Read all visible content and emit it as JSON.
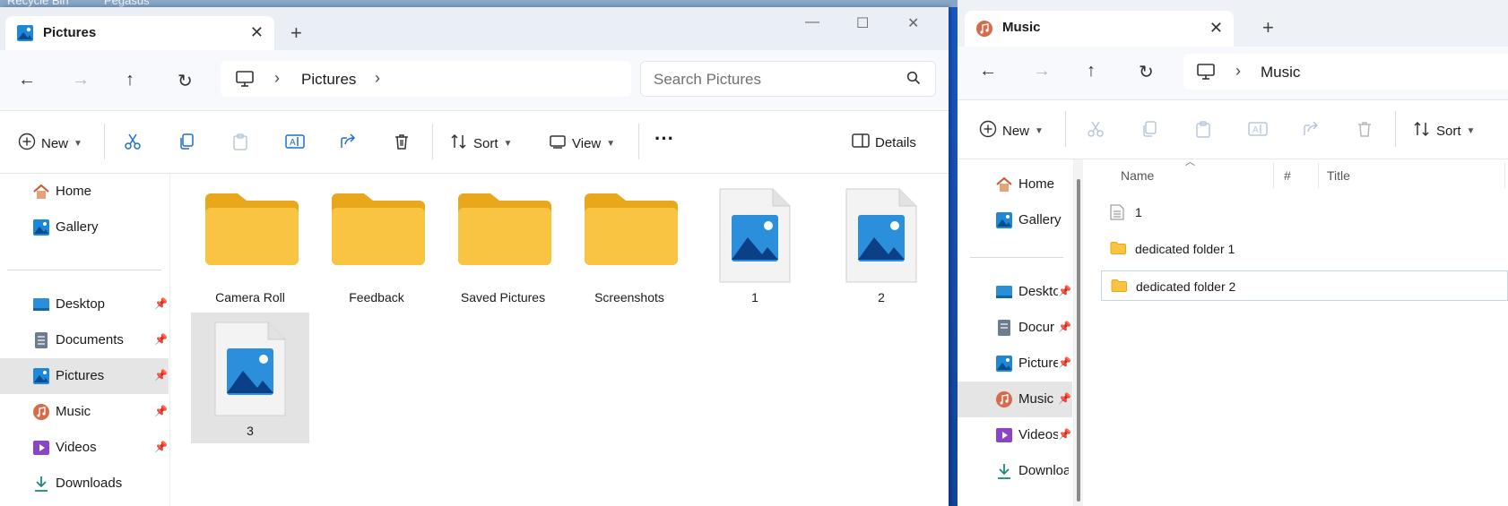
{
  "desktop": {
    "icons": [
      "Recycle Bin",
      "Pegasus"
    ]
  },
  "left_window": {
    "tab_title": "Pictures",
    "breadcrumb": "Pictures",
    "search_placeholder": "Search Pictures",
    "command_bar": {
      "new": "New",
      "sort": "Sort",
      "view": "View",
      "details": "Details"
    },
    "sidebar": {
      "home": "Home",
      "gallery": "Gallery",
      "desktop": "Desktop",
      "documents": "Documents",
      "pictures": "Pictures",
      "music": "Music",
      "videos": "Videos",
      "downloads": "Downloads"
    },
    "items": [
      {
        "name": "Camera Roll",
        "type": "folder"
      },
      {
        "name": "Feedback",
        "type": "folder"
      },
      {
        "name": "Saved Pictures",
        "type": "folder"
      },
      {
        "name": "Screenshots",
        "type": "folder"
      },
      {
        "name": "1",
        "type": "image"
      },
      {
        "name": "2",
        "type": "image"
      },
      {
        "name": "3",
        "type": "image",
        "selected": true
      }
    ]
  },
  "right_window": {
    "tab_title": "Music",
    "breadcrumb": "Music",
    "command_bar": {
      "new": "New",
      "sort": "Sort"
    },
    "sidebar": {
      "home": "Home",
      "gallery": "Gallery",
      "desktop": "Deskto",
      "documents": "Docur",
      "pictures": "Picture",
      "music": "Music",
      "videos": "Videos",
      "downloads": "Downloa"
    },
    "columns": {
      "name": "Name",
      "number": "#",
      "title": "Title"
    },
    "rows": [
      {
        "name": "1",
        "type": "file"
      },
      {
        "name": "dedicated folder 1",
        "type": "folder"
      },
      {
        "name": "dedicated folder 2",
        "type": "folder",
        "selected": true
      }
    ]
  },
  "colors": {
    "folder": "#f9c441",
    "folder_dark": "#e9a81b",
    "image_blue": "#1e88d8",
    "selected": "#e5e5e5"
  }
}
